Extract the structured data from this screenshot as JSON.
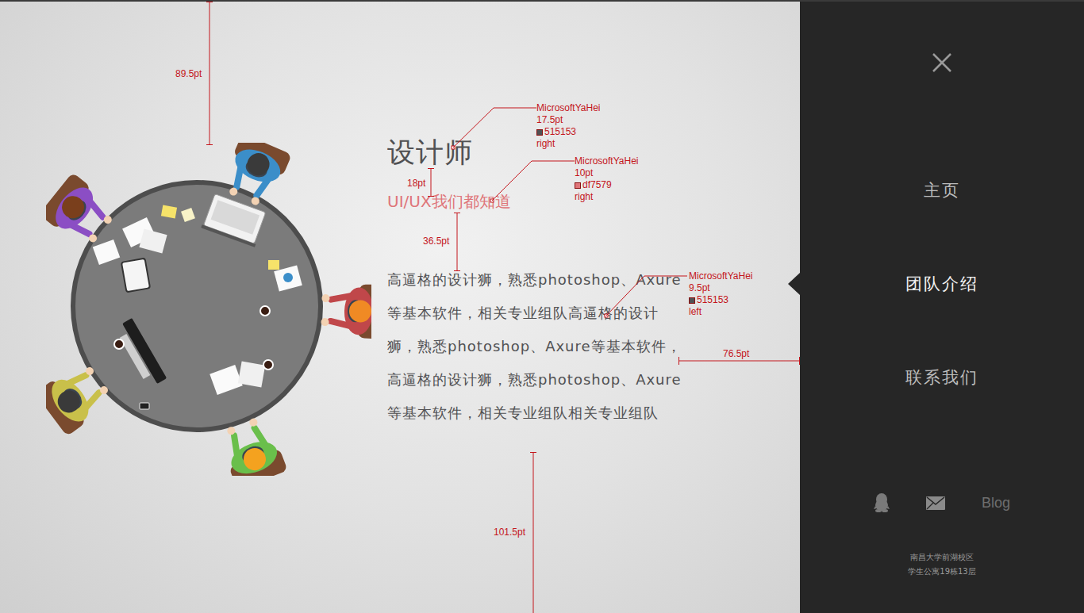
{
  "content": {
    "title": "设计师",
    "subtitle": "UI/UX我们都知道",
    "body": "高逼格的设计狮，熟悉photoshop、Axure等基本软件，相关专业组队高逼格的设计狮，熟悉photoshop、Axure等基本软件，高逼格的设计狮，熟悉photoshop、Axure等基本软件，相关专业组队相关专业组队"
  },
  "annotations": {
    "dimensions": [
      {
        "label": "89.5pt"
      },
      {
        "label": "18pt"
      },
      {
        "label": "36.5pt"
      },
      {
        "label": "76.5pt"
      },
      {
        "label": "101.5pt"
      }
    ],
    "callouts": [
      {
        "font": "MicrosoftYaHei",
        "size": "17.5pt",
        "swatch": "515153",
        "color": "#515153",
        "align": "right"
      },
      {
        "font": "MicrosoftYaHei",
        "size": "10pt",
        "swatch": "df7579",
        "color": "#df7579",
        "align": "right"
      },
      {
        "font": "MicrosoftYaHei",
        "size": "9.5pt",
        "swatch": "515153",
        "color": "#515153",
        "align": "left"
      }
    ]
  },
  "sidebar": {
    "nav": [
      {
        "label": "主页",
        "selected": false
      },
      {
        "label": "团队介绍",
        "selected": true
      },
      {
        "label": "联系我们",
        "selected": false
      }
    ],
    "blog_link": "Blog",
    "address": [
      "南昌大学前湖校区",
      "学生公寓19栋13层"
    ]
  }
}
